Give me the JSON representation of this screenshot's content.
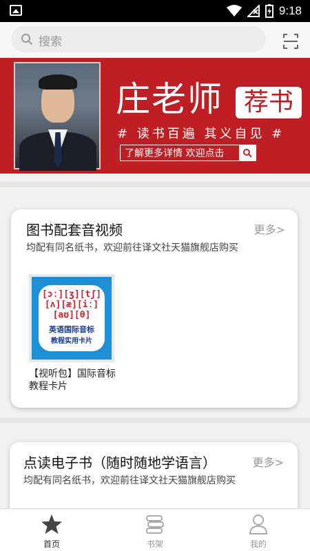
{
  "status_bar": {
    "time": "9:18"
  },
  "search": {
    "placeholder": "搜索"
  },
  "banner": {
    "title": "庄老师",
    "tag": "荐书",
    "slogan": "# 读书百遍 其义自见 #",
    "cta": "了解更多详情 欢迎点击"
  },
  "sections": [
    {
      "title": "图书配套音视频",
      "more": "更多>",
      "desc": "均配有同名纸书，欢迎前往译文社天猫旗舰店购买",
      "items": [
        {
          "name": "【视听包】国际音标教程卡片",
          "cover_ipa": "[ɔː][ʒ][tʃ] [ʌ][æ][iː] [aʊ][θ]",
          "cover_line1": "英语国际音标",
          "cover_line2": "教程实用卡片"
        }
      ]
    },
    {
      "title": "点读电子书（随时随地学语言）",
      "more": "更多>",
      "desc": "均配有同名纸书，欢迎前往译文社天猫旗舰店购买"
    }
  ],
  "bottom_nav": [
    {
      "label": "首页",
      "icon": "star-icon",
      "active": true
    },
    {
      "label": "书架",
      "icon": "bookshelf-icon",
      "active": false
    },
    {
      "label": "我的",
      "icon": "person-icon",
      "active": false
    }
  ],
  "colors": {
    "banner_red": "#bf1e25",
    "cover_blue": "#1e8fd6"
  }
}
